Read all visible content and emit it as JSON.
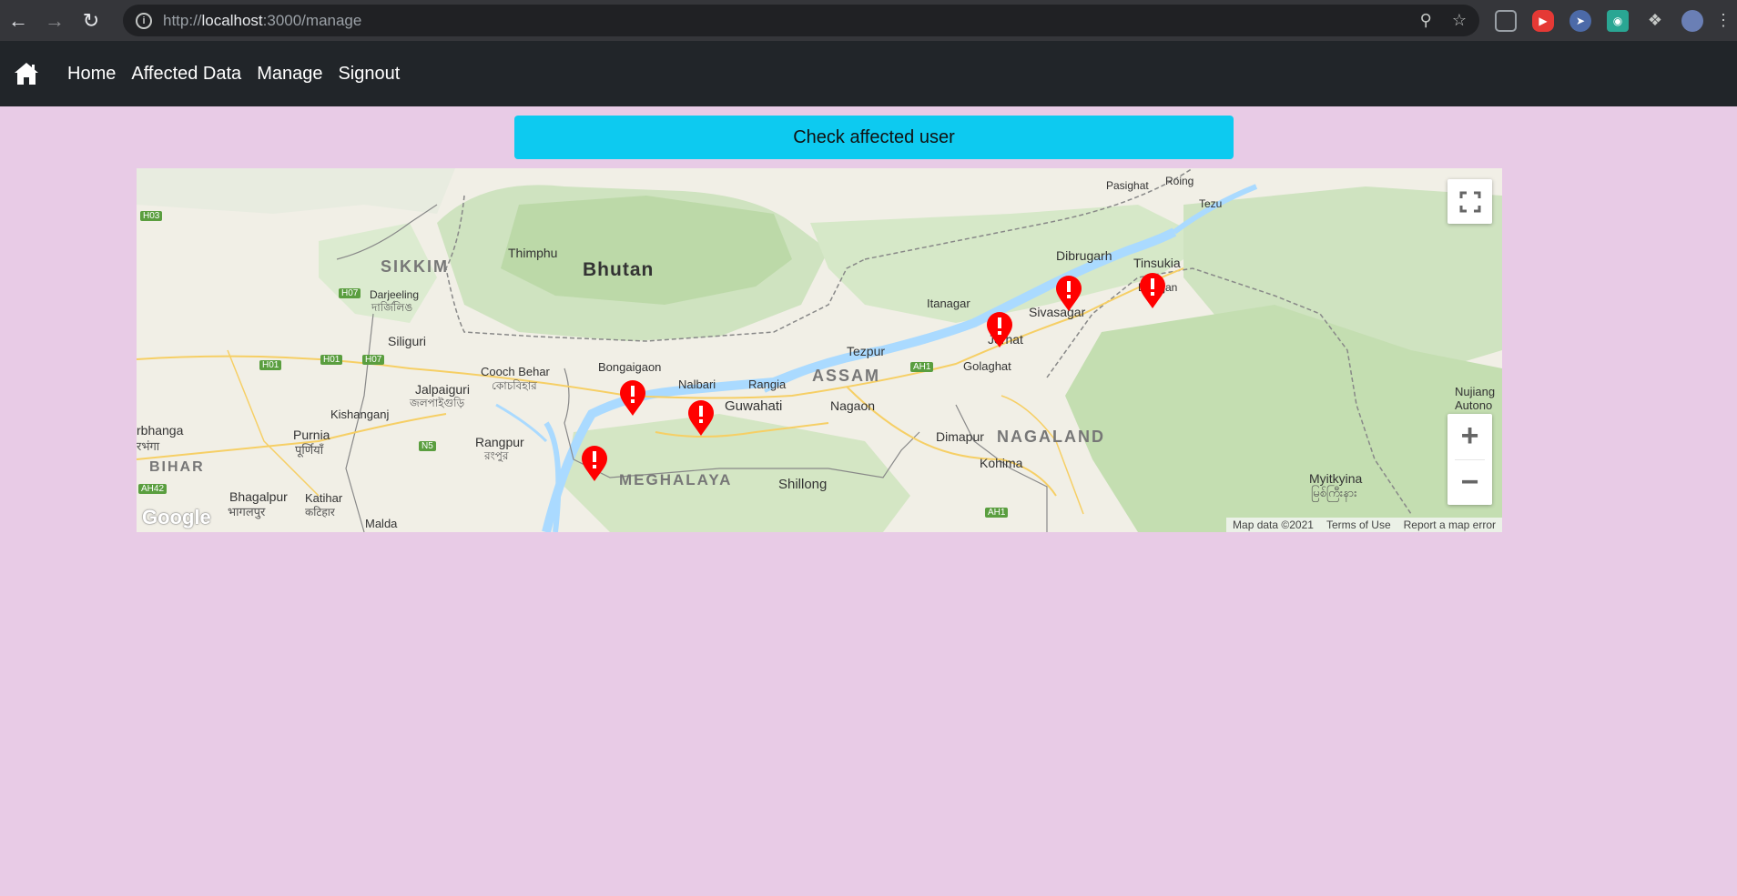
{
  "browser": {
    "url_prefix": "http://",
    "url_host": "localhost",
    "url_rest": ":3000/manage",
    "extensions": [
      "puzzle-extension",
      "profile-avatar"
    ]
  },
  "navbar": {
    "links": [
      {
        "label": "Home"
      },
      {
        "label": "Affected Data"
      },
      {
        "label": "Manage"
      },
      {
        "label": "Signout"
      }
    ]
  },
  "actions": {
    "check_label": "Check affected user"
  },
  "map": {
    "labels": {
      "thimphu": "Thimphu",
      "bhutan": "Bhutan",
      "sikkim": "SIKKIM",
      "darjeeling": "Darjeeling",
      "darjeeling_script": "দার্জিলিঙ",
      "siliguri": "Siliguri",
      "itanagar": "Itanagar",
      "dibrugarh": "Dibrugarh",
      "tinsukia": "Tinsukia",
      "duliajan": "Duliajan",
      "sivasagar": "Sivasagar",
      "jorhat": "Jorhat",
      "golaghat": "Golaghat",
      "tezpur": "Tezpur",
      "assam": "ASSAM",
      "nagaon": "Nagaon",
      "guwahati": "Guwahati",
      "nalbari": "Nalbari",
      "rangia": "Rangia",
      "bongaigaon": "Bongaigaon",
      "cooch_behar": "Cooch Behar",
      "cooch_behar_script": "কোচবিহার",
      "jalpaiguri": "Jalpaiguri",
      "jalpaiguri_script": "জলপাইগুড়ি",
      "kishanganj": "Kishanganj",
      "purnia": "Purnia",
      "purnia_script": "पूर्णियाँ",
      "bhagalpur": "Bhagalpur",
      "bhagalpur_script": "भागलपुर",
      "katihar": "Katihar",
      "katihar_script": "कटिहार",
      "malda": "Malda",
      "bihar": "BIHAR",
      "darbhanga": "rbhanga",
      "darbhanga_script": "रभंगा",
      "rangpur": "Rangpur",
      "rangpur_script": "রংপুর",
      "meghalaya": "MEGHALAYA",
      "shillong": "Shillong",
      "dimapur": "Dimapur",
      "nagaland": "NAGALAND",
      "kohima": "Kohima",
      "myitkyina": "Myitkyina",
      "myitkyina_script": "မြစ်ကြီးနား",
      "nujiang": "Nujiang",
      "autono": "Autono",
      "pasighat": "Pasighat",
      "tezu": "Tezu",
      "roing": "Roing"
    },
    "road_shields": {
      "h03": "H03",
      "h07a": "H07",
      "h01a": "H01",
      "h01b": "H01",
      "h07b": "H07",
      "n5": "N5",
      "ah1a": "AH1",
      "ah1b": "AH1",
      "ah42": "AH42"
    },
    "attribution": {
      "map_data": "Map data ©2021",
      "terms": "Terms of Use",
      "report": "Report a map error"
    },
    "logo": "Google",
    "marker_count": 6,
    "marker_color": "#ff0000"
  }
}
